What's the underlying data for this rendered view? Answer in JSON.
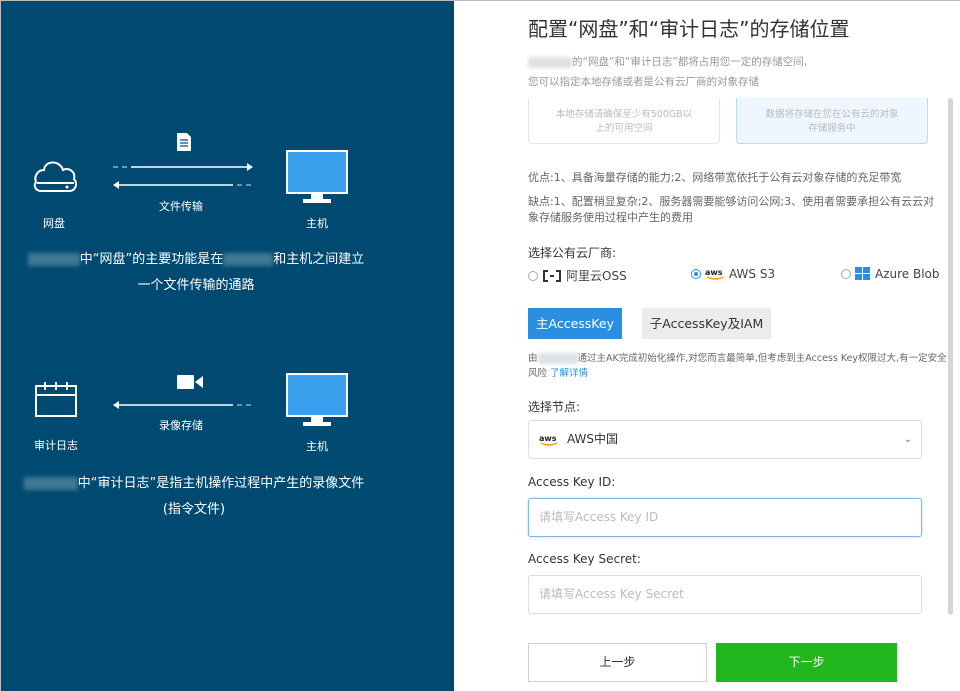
{
  "left": {
    "netdisk_label": "网盘",
    "transfer_label": "文件传输",
    "host_label_1": "主机",
    "netdisk_desc_line1": "中“网盘”的主要功能是在",
    "netdisk_desc_line1b": "和主机之间建立",
    "netdisk_desc_line2": "一个文件传输的通路",
    "audit_label": "审计日志",
    "record_label": "录像存储",
    "host_label_2": "主机",
    "audit_desc_line1": "中“审计日志”是指主机操作过程中产生的录像文件",
    "audit_desc_line2": "(指令文件)"
  },
  "right": {
    "title": "配置“网盘”和“审计日志”的存储位置",
    "intro_line1": "的“网盘”和“审计日志”都将占用您一定的存储空间,",
    "intro_line2": "您可以指定本地存储或者是公有云厂商的对象存储",
    "card_local": "本地存储请确保至少有500GB以上的可用空间",
    "card_cloud": "数据将存储在您在公有云的对象存储服务中",
    "pros": "优点:1、具备海量存储的能力;2、网络带宽依托于公有云对象存储的充足带宽",
    "cons": "缺点:1、配置稍显复杂;2、服务器需要能够访问公网;3、使用者需要承担公有云云对象存储服务使用过程中产生的费用",
    "provider_label": "选择公有云厂商:",
    "providers": [
      {
        "label": "阿里云OSS",
        "icon": "aliyun-icon",
        "selected": false
      },
      {
        "label": "AWS S3",
        "icon": "aws-icon",
        "selected": true
      },
      {
        "label": "Azure Blob",
        "icon": "windows-icon",
        "selected": false
      }
    ],
    "tab_main": "主AccessKey",
    "tab_sub": "子AccessKey及IAM",
    "note_prefix": "由",
    "note_text": "通过主AK完成初始化操作,对您而言最简单,但考虑到主Access Key权限过大,有一定安全风险",
    "note_link": "了解详情",
    "node_label": "选择节点:",
    "node_value": "AWS中国",
    "akid_label": "Access Key ID:",
    "akid_placeholder": "请填写Access Key ID",
    "aks_label": "Access Key Secret:",
    "aks_placeholder": "请填写Access Key Secret",
    "btn_prev": "上一步",
    "btn_next": "下一步"
  },
  "colors": {
    "left_bg": "#004a72",
    "accent": "#2a8ee3",
    "next_button": "#22b61f",
    "screen_blue": "#3aa0ee"
  }
}
